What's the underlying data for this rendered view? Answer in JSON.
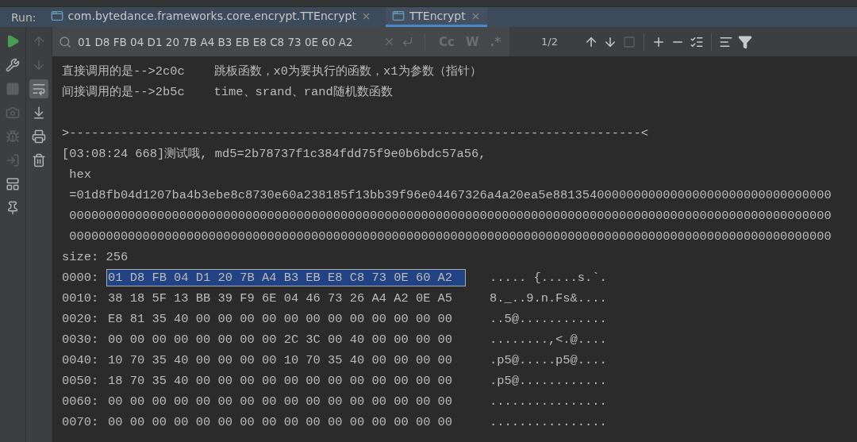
{
  "run_label": "Run:",
  "tabs": [
    {
      "label": "com.bytedance.frameworks.core.encrypt.TTEncrypt",
      "selected": false
    },
    {
      "label": "TTEncrypt",
      "selected": true
    }
  ],
  "run_toolbar": [
    {
      "kind": "run",
      "disabled": false
    },
    {
      "kind": "wrench",
      "disabled": false
    },
    {
      "kind": "stop",
      "disabled": true
    },
    {
      "kind": "camera",
      "disabled": true
    },
    {
      "kind": "bug",
      "disabled": true
    },
    {
      "kind": "exit",
      "disabled": true
    },
    {
      "kind": "layout",
      "disabled": false
    },
    {
      "kind": "pin",
      "disabled": false
    }
  ],
  "console_toolbar": [
    {
      "kind": "up",
      "disabled": true,
      "on": false
    },
    {
      "kind": "down",
      "disabled": true,
      "on": false
    },
    {
      "kind": "wrap",
      "disabled": false,
      "on": true
    },
    {
      "kind": "scroll-end",
      "disabled": false,
      "on": false
    },
    {
      "kind": "print",
      "disabled": false,
      "on": false
    },
    {
      "kind": "trash",
      "disabled": false,
      "on": false
    }
  ],
  "search": {
    "value": "01 D8 FB 04 D1 20 7B A4 B3 EB E8 C8 73 0E 60 A2",
    "options": [
      {
        "label": "Cc",
        "selected": false
      },
      {
        "label": "W",
        "selected": false
      },
      {
        "label": ".*",
        "selected": false
      }
    ],
    "match_count": "1/2"
  },
  "console_lines": [
    {
      "kind": "text",
      "text": "直接调用的是-->2c0c    跳板函数，x0为要执行的函数，x1为参数（指针）"
    },
    {
      "kind": "text",
      "text": "间接调用的是-->2b5c    time、srand、rand随机数函数"
    },
    {
      "kind": "separator",
      "text": ">------------------------------------------------------------------------------<"
    },
    {
      "kind": "text",
      "text": "[03:08:24 668]测试哦, md5=2b78737f1c384fdd75f9e0b6bdc57a56,"
    },
    {
      "kind": "text",
      "text": " hex"
    },
    {
      "kind": "text",
      "text": " =01d8fb04d1207ba4b3ebe8c8730e60a238185f13bb39f96e04467326a4a20ea5e88135400000000000000000000000000000000"
    },
    {
      "kind": "text",
      "text": " 00000000000000000000000000000000000000000000000000000000000000000000000000000000000000000000000000000000"
    },
    {
      "kind": "text",
      "text": " 00000000000000000000000000000000000000000000000000000000000000000000000000000000000000000000000000000000"
    },
    {
      "kind": "text",
      "text": "size: 256"
    }
  ],
  "hex_rows": [
    {
      "offset": "0000:",
      "bytes": "01 D8 FB 04 D1 20 7B A4 B3 EB E8 C8 73 0E 60 A2",
      "ascii": "..... {.....s.`.",
      "highlighted": true
    },
    {
      "offset": "0010:",
      "bytes": "38 18 5F 13 BB 39 F9 6E 04 46 73 26 A4 A2 0E A5",
      "ascii": "8._..9.n.Fs&....",
      "highlighted": false
    },
    {
      "offset": "0020:",
      "bytes": "E8 81 35 40 00 00 00 00 00 00 00 00 00 00 00 00",
      "ascii": "..5@............",
      "highlighted": false
    },
    {
      "offset": "0030:",
      "bytes": "00 00 00 00 00 00 00 00 2C 3C 00 40 00 00 00 00",
      "ascii": "........,<.@....",
      "highlighted": false
    },
    {
      "offset": "0040:",
      "bytes": "10 70 35 40 00 00 00 00 10 70 35 40 00 00 00 00",
      "ascii": ".p5@.....p5@....",
      "highlighted": false
    },
    {
      "offset": "0050:",
      "bytes": "18 70 35 40 00 00 00 00 00 00 00 00 00 00 00 00",
      "ascii": ".p5@............",
      "highlighted": false
    },
    {
      "offset": "0060:",
      "bytes": "00 00 00 00 00 00 00 00 00 00 00 00 00 00 00 00",
      "ascii": "................",
      "highlighted": false
    },
    {
      "offset": "0070:",
      "bytes": "00 00 00 00 00 00 00 00 00 00 00 00 00 00 00 00",
      "ascii": "................",
      "highlighted": false
    }
  ]
}
